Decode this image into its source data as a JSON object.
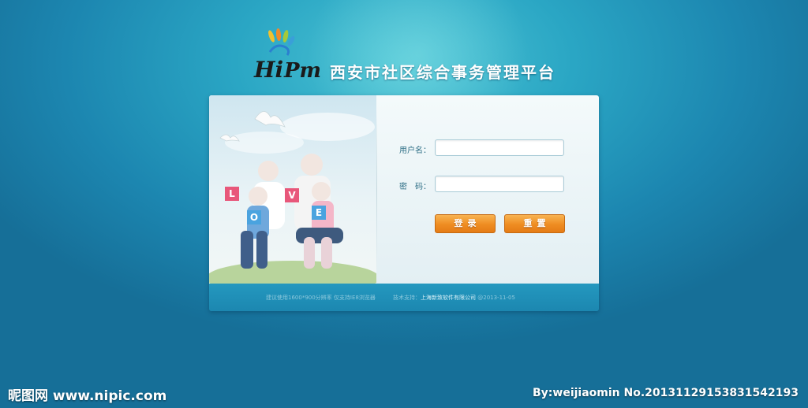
{
  "header": {
    "logo_text": "Hi Pm",
    "title": "西安市社区综合事务管理平台"
  },
  "photo": {
    "cards": [
      "L",
      "O",
      "V",
      "E"
    ]
  },
  "form": {
    "username_label": "用户名：",
    "password_label": "密　码：",
    "username_value": "",
    "password_value": "",
    "login_label": "登录",
    "reset_label": "重置"
  },
  "footer": {
    "resolution_note": "建议使用1600*900分辨率  仅支持IE8浏览器",
    "support_prefix": "技术支持：",
    "support_company": "上海新致软件有限公司",
    "date": "@2013-11-05"
  },
  "watermark": {
    "site": "昵图网 www.nipic.com",
    "author": "By:weijiaomin  No.20131129153831542193"
  },
  "colors": {
    "background": "#1f8fb8",
    "button": "#ef8d22",
    "footer_bar": "#1c87b0"
  }
}
